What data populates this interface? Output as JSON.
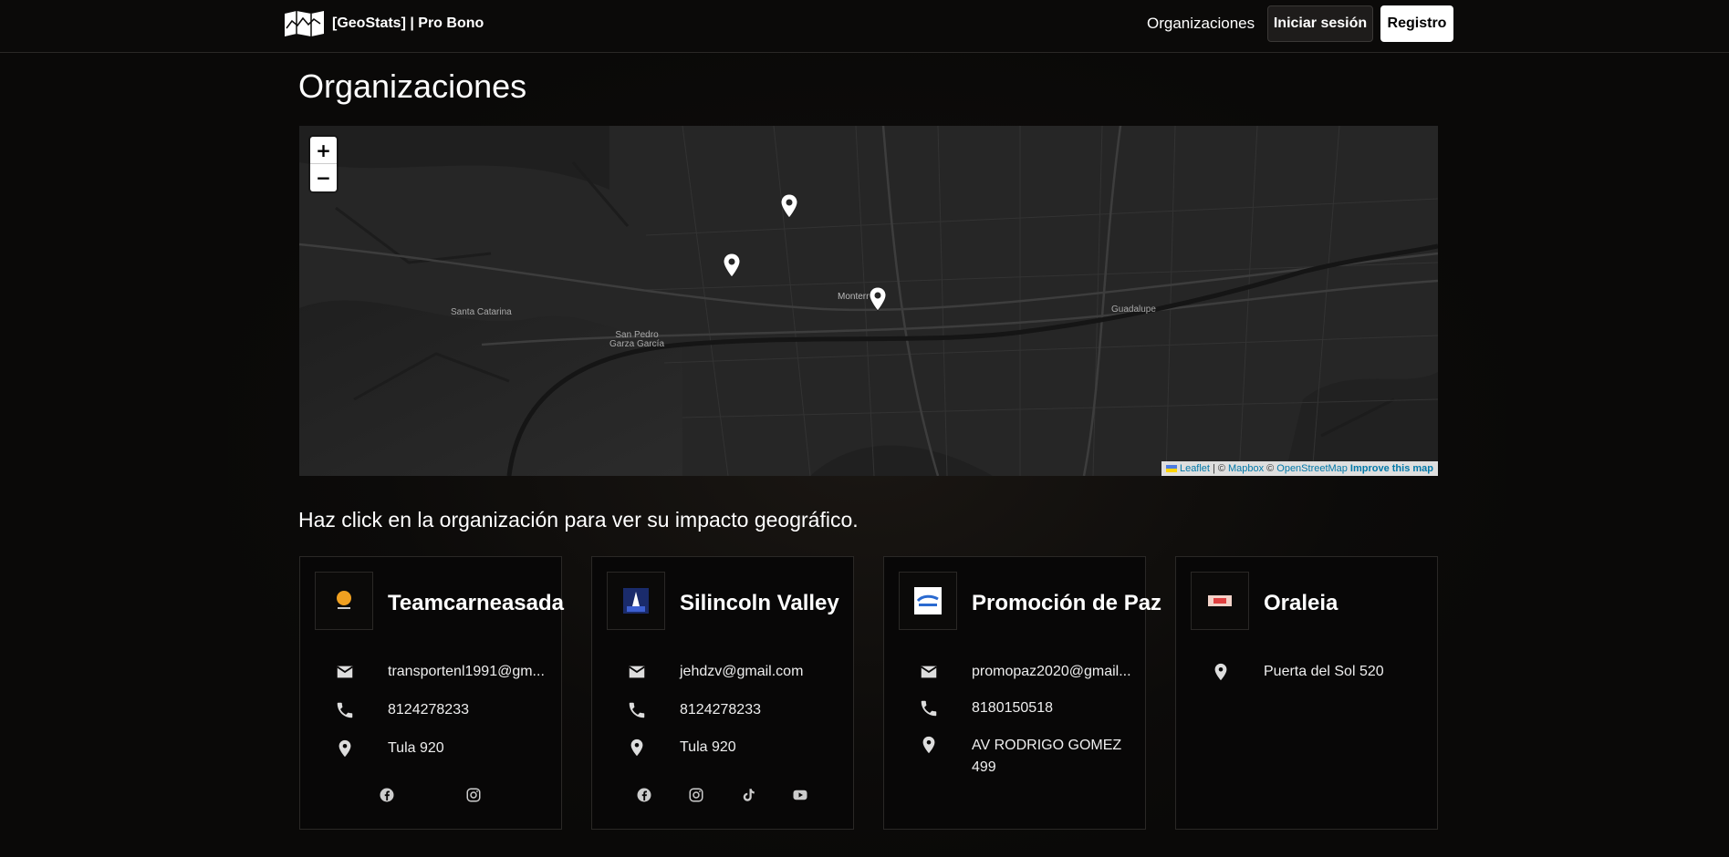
{
  "navbar": {
    "brand": "[GeoStats] | Pro Bono",
    "link": "Organizaciones",
    "login_label": "Iniciar sesión",
    "register_label": "Registro"
  },
  "page": {
    "title": "Organizaciones",
    "subtitle": "Haz click en la organización para ver su impacto geográfico."
  },
  "map": {
    "zoom_in": "+",
    "zoom_out": "−",
    "labels": {
      "monterrey": "Monterrey",
      "guadalupe": "Guadalupe",
      "santa_catarina": "Santa Catarina",
      "san_pedro": "San Pedro\nGarza García"
    },
    "attribution": {
      "leaflet": "Leaflet",
      "sep": "| ©",
      "mapbox": "Mapbox",
      "copy": "©",
      "osm": "OpenStreetMap",
      "improve": "Improve this map"
    }
  },
  "organizations": [
    {
      "name": "Teamcarneasada",
      "email": "transportenl1991@gm...",
      "phone": "8124278233",
      "address": "Tula 920",
      "socials": [
        "facebook-icon",
        "instagram-icon"
      ]
    },
    {
      "name": "Silincoln Valley",
      "email": "jehdzv@gmail.com",
      "phone": "8124278233",
      "address": "Tula 920",
      "socials": [
        "facebook-icon",
        "instagram-icon",
        "tiktok-icon",
        "youtube-icon"
      ]
    },
    {
      "name": "Promoción de Paz",
      "email": "promopaz2020@gmail...",
      "phone": "8180150518",
      "address": "AV RODRIGO GOMEZ 499",
      "socials": []
    },
    {
      "name": "Oraleia",
      "address": "Puerta del Sol 520",
      "socials": []
    }
  ]
}
